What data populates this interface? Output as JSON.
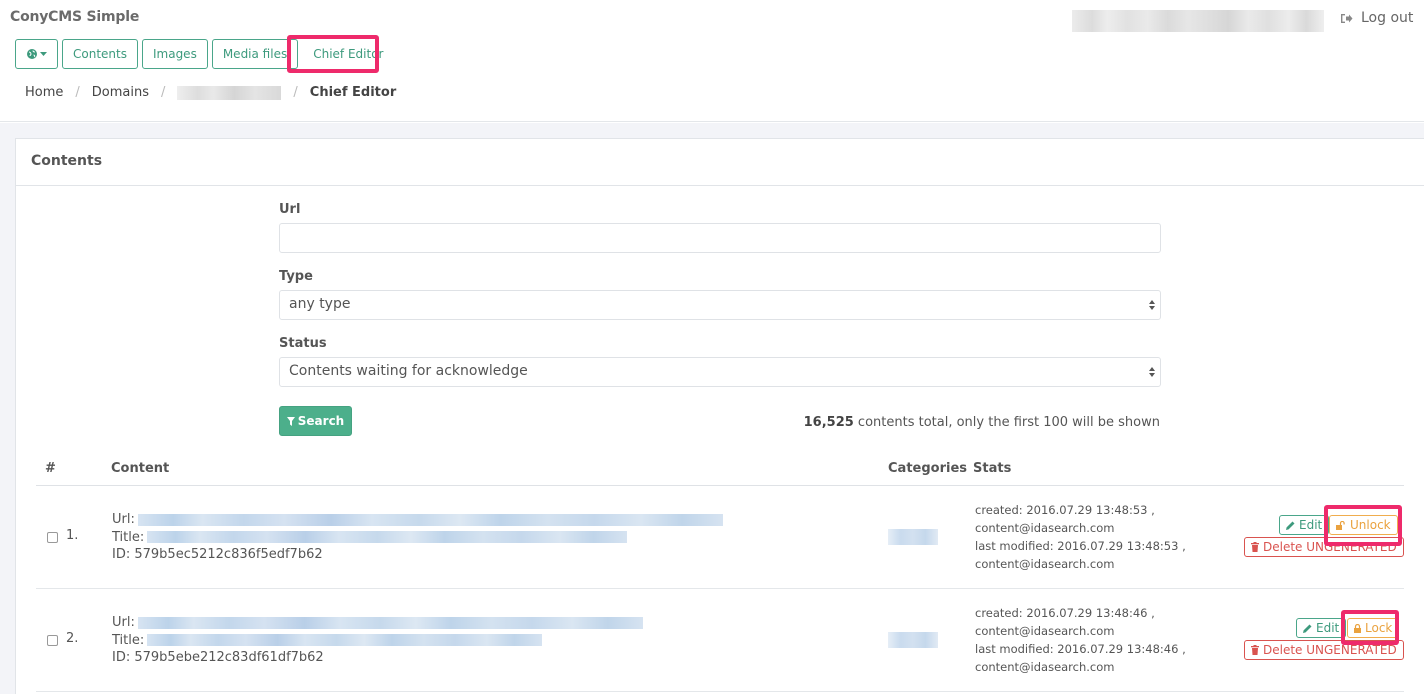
{
  "app": {
    "title": "ConyCMS Simple",
    "logout_label": "Log out"
  },
  "nav": {
    "items": [
      {
        "label": "Contents"
      },
      {
        "label": "Images"
      },
      {
        "label": "Media files"
      },
      {
        "label": "Chief Editor"
      }
    ]
  },
  "breadcrumb": {
    "items": [
      "Home",
      "Domains",
      "Chief Editor"
    ]
  },
  "panel": {
    "title": "Contents"
  },
  "filters": {
    "url_label": "Url",
    "url_value": "",
    "type_label": "Type",
    "type_value": "any type",
    "status_label": "Status",
    "status_value": "Contents waiting for acknowledge",
    "search_label": "Search"
  },
  "summary": {
    "count": "16,525",
    "text": " contents total, only the first 100 will be shown"
  },
  "table": {
    "columns": [
      "#",
      "Content",
      "Categories",
      "Stats"
    ],
    "rows": [
      {
        "num": "1.",
        "url_label": "Url:",
        "title_label": "Title:",
        "id": "ID: 579b5ec5212c836f5edf7b62",
        "created": "created: 2016.07.29 13:48:53 ,",
        "created_by": "content@idasearch.com",
        "modified": "last modified: 2016.07.29 13:48:53 ,",
        "modified_by": "content@idasearch.com",
        "edit_label": "Edit",
        "lock_label": "Unlock",
        "delete_label": "Delete UNGENERATED"
      },
      {
        "num": "2.",
        "url_label": "Url:",
        "title_label": "Title:",
        "id": "ID: 579b5ebe212c83df61df7b62",
        "created": "created: 2016.07.29 13:48:46 ,",
        "created_by": "content@idasearch.com",
        "modified": "last modified: 2016.07.29 13:48:46 ,",
        "modified_by": "content@idasearch.com",
        "edit_label": "Edit",
        "lock_label": "Lock",
        "delete_label": "Delete UNGENERATED"
      }
    ]
  },
  "colors": {
    "primary": "#4caf8b",
    "warning": "#f0ad4e",
    "danger": "#d9534f",
    "highlight": "#ee2a6b"
  },
  "icons": {
    "globe": "globe-icon",
    "logout": "sign-out-icon",
    "filter": "filter-icon",
    "edit": "pencil-icon",
    "unlock": "unlock-icon",
    "lock": "lock-icon",
    "delete": "trash-icon"
  }
}
